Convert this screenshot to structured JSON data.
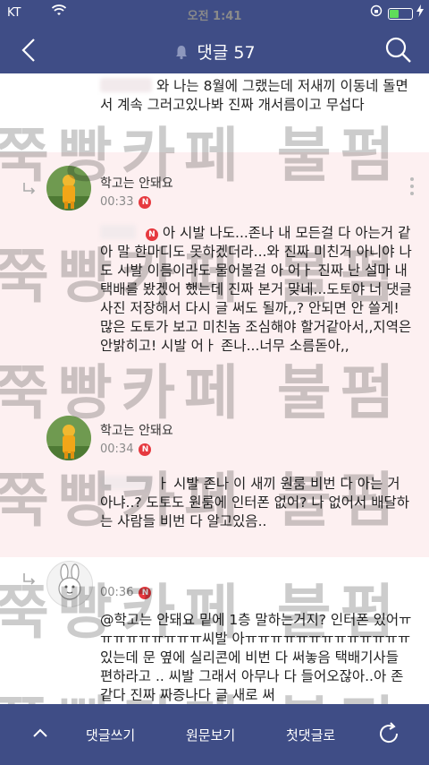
{
  "status_bar": {
    "carrier": "KT",
    "time": "오전 1:41",
    "battery_level": 0.4
  },
  "nav": {
    "title": "댓글 57",
    "icons": [
      "back-icon",
      "bell-icon",
      "search-icon"
    ]
  },
  "comments": [
    {
      "text_after_redaction": "와 나는 8월에 그랬는데 저새끼 이동네 돌면서 계속 그러고있나봐 진짜 개서름이고 무섭다"
    },
    {
      "author": "학고는 안돼요",
      "time": "00:33",
      "badge": "N",
      "text_lead": "아 시발 나도...존나 내 모든걸 다 아는거",
      "text": "같아 말 한마디도 못하겠더라...와 진짜 미친거 아니야 나도 시발 이름이라도 물어볼걸 아 어ㅏ 진짜 난 설마 내 택배를 봤겠어 했는데 진짜 본거 맞네...도토야 너 댓글 사진 저장해서 다시 글 써도 될까,,? 안되면 안 쓸게! 많은 도토가 보고 미친놈 조심해야 할거같아서,,지역은 안밝히고! 시발 어ㅏ 존나...너무 소름돋아,,"
    },
    {
      "author": "학고는 안돼요",
      "time": "00:34",
      "badge": "N",
      "text_lead": "ㅏ 시발 존나 이 새끼 원룸 비번 다 아는",
      "text": "거 아냐..? 도토도 원룸에 인터폰 없어? 나 없어서 배달하는 사람들 비번 다 알고있음.."
    },
    {
      "author": "@학고는 안돼요",
      "time": "00:36",
      "badge": "N",
      "text": "밑에 1층 말하는거지? 인터폰 있어ㅠㅠㅠㅠㅠㅠㅠㅠㅠ씨발 아ㅠㅠㅠㅠㅠㅠㅠㅠㅠㅠㅠㅠㅠ 있는데 문 옆에 실리콘에 비번 다 써놓음 택배기사들 편하라고 .. 씨발 그래서 아무나 다 들어오잖아..아 존같다 진짜 짜증나다 글 새로 써"
    }
  ],
  "watermark": "쭉빵카페 불펌 금지",
  "bottom_bar": {
    "write": "댓글쓰기",
    "original": "원문보기",
    "first": "첫댓글로",
    "icons": [
      "up-arrow-icon",
      "refresh-icon"
    ]
  }
}
